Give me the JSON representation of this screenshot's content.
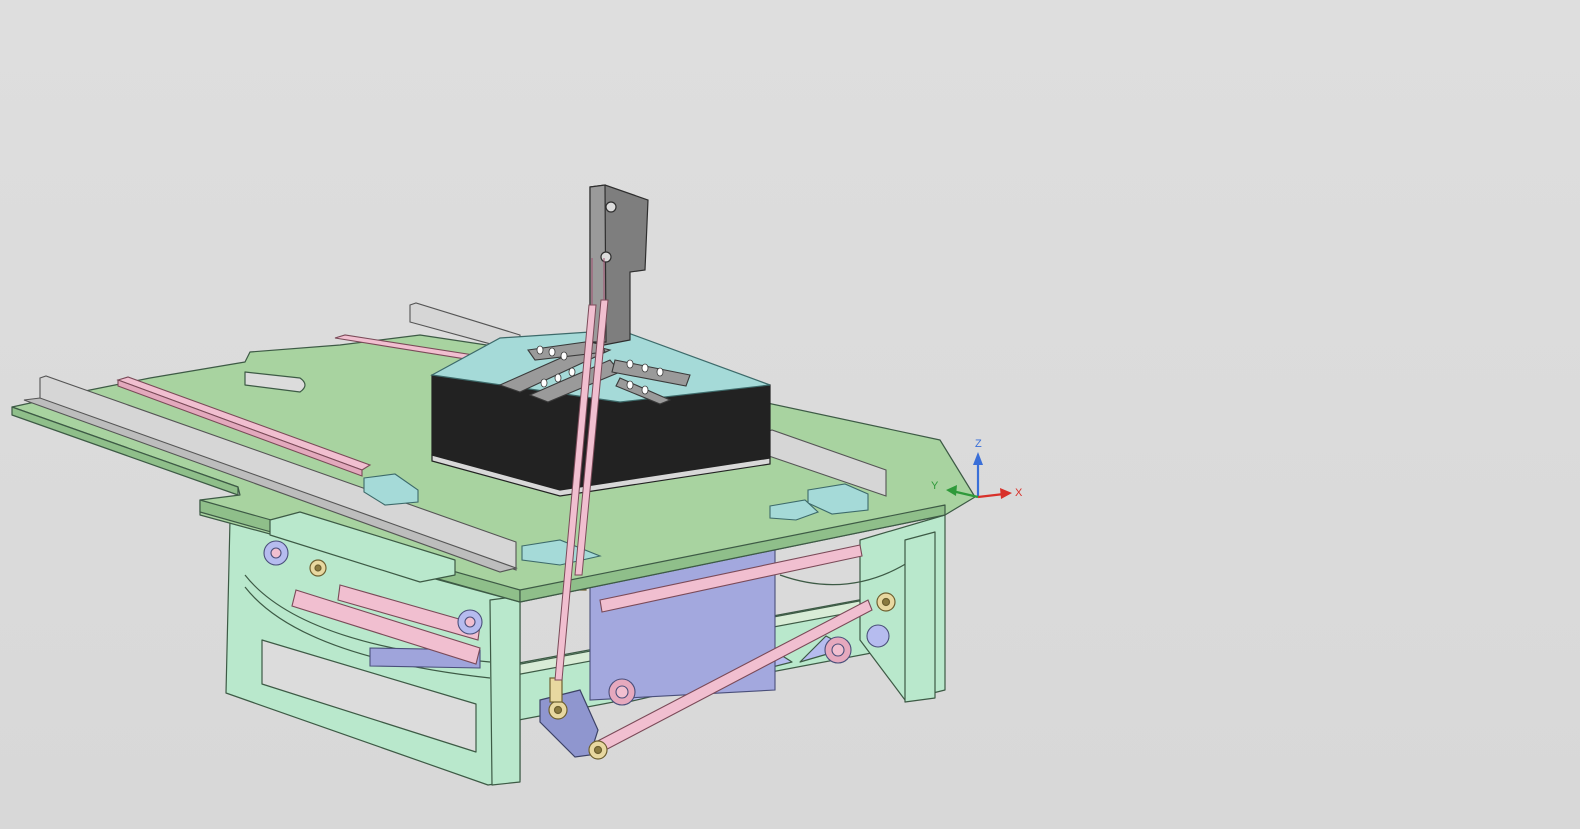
{
  "viewport": {
    "background_color": "#dcdcdc",
    "model_colors": {
      "frame_green": "#a8d3a0",
      "frame_mint": "#b9e8cc",
      "rod_pink": "#f1bfd0",
      "part_lavender": "#b6bcef",
      "plate_cyan": "#a5dad8",
      "block_black": "#222222",
      "bracket_gray": "#8a8a8a",
      "rail_silver": "#d6d6d6",
      "rod_end_gold": "#e8d8a0"
    }
  },
  "triad": {
    "z_label": "Z",
    "y_label": "Y",
    "x_label": "X",
    "z_color": "#3a6fd8",
    "y_color": "#2e9a3a",
    "x_color": "#d8312a"
  }
}
